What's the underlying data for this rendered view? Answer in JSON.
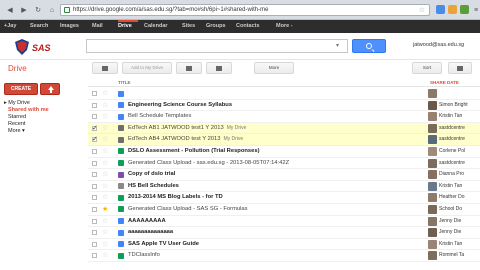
{
  "browser": {
    "url": "https://drive.google.com/a/sas.edu.sg/?tab=mo#sh/6pi~1#shared-with-me"
  },
  "gbar": {
    "items": [
      "+Jay",
      "Search",
      "Images",
      "Mail",
      "Drive",
      "Calendar",
      "Sites",
      "Groups",
      "Contacts",
      "More -"
    ]
  },
  "header": {
    "logo_text": "SAS",
    "search_placeholder": "",
    "user_email": "jatwood@sas.edu.sg"
  },
  "drive_title": "Drive",
  "toolbar": {
    "add_to_drive": "Add to My Drive",
    "more": "More",
    "sort": "Sort"
  },
  "sidebar": {
    "create_label": "CREATE",
    "items": [
      "My Drive",
      "Shared with me",
      "Starred",
      "Recent",
      "More"
    ]
  },
  "list": {
    "title_header": "TITLE",
    "share_header": "SHARE DATE",
    "rows": [
      {
        "name": "",
        "type": "doc",
        "owner": "",
        "bold": true
      },
      {
        "name": "Engineering Science Course Syllabus",
        "type": "doc",
        "owner": "Simon Bright",
        "bold": true
      },
      {
        "name": "Bell Schedule Templates",
        "type": "doc",
        "owner": "Kristin Tan",
        "bold": false
      },
      {
        "name": "EdTech AB1 JATWOOD test1 Y 2013",
        "tag": "My Drive",
        "type": "shared",
        "owner": "sastdcentre",
        "bold": false,
        "selected": true,
        "checked": true
      },
      {
        "name": "EdTech AB4 JATWOOD test Y 2013",
        "tag": "My Drive",
        "type": "shared",
        "owner": "sastdcentre",
        "bold": false,
        "selected": true,
        "checked": true
      },
      {
        "name": "DSLO Assessment - Pollution (Trial Responses)",
        "type": "sheet",
        "owner": "Corlene Pol",
        "bold": true
      },
      {
        "name": "Generated Class Upload - sas.edu.sg - 2013-08-05T07:14:42Z",
        "type": "sheet",
        "owner": "sastdcentre",
        "bold": false
      },
      {
        "name": "Copy of dslo trial",
        "type": "form",
        "owner": "Dianna Pro",
        "bold": true
      },
      {
        "name": "HS Bell Schedules",
        "type": "folder",
        "owner": "Kristin Tan",
        "bold": true
      },
      {
        "name": "2013-2014 MS Blog Labels - for TD",
        "type": "sheet",
        "owner": "Heather Do",
        "bold": true
      },
      {
        "name": "Generated Class Upload - SAS SG - Formulas",
        "type": "sheet",
        "owner": "School Do",
        "bold": false,
        "starred": true
      },
      {
        "name": "AAAAAAAAA",
        "type": "doc",
        "owner": "Jenny Die",
        "bold": true
      },
      {
        "name": "aaaaaaaaaaaaaa",
        "type": "doc",
        "owner": "Jenny Die",
        "bold": true
      },
      {
        "name": "SAS Apple TV User Guide",
        "type": "doc",
        "owner": "Kristin Tan",
        "bold": true
      },
      {
        "name": "TDClassInfo",
        "type": "sheet",
        "owner": "Rommel Ta",
        "bold": false
      }
    ]
  }
}
